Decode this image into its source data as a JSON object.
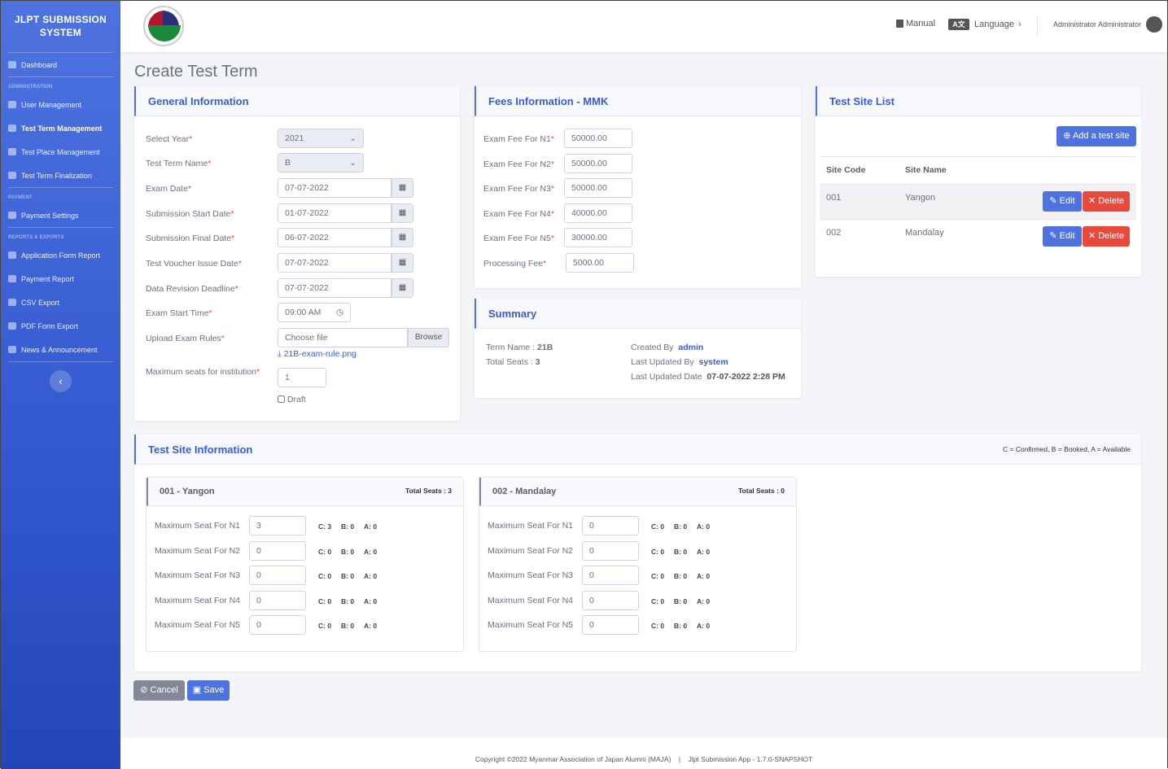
{
  "app": {
    "brand": "JLPT SUBMISSION SYSTEM",
    "logo_text": "Myanmar Association of Japan Alumni"
  },
  "sidebar": {
    "items": [
      {
        "type": "item",
        "label": "Dashboard",
        "icon": "tachometer-icon"
      },
      {
        "type": "head",
        "label": "ADMINISTRATION"
      },
      {
        "type": "item",
        "label": "User Management",
        "icon": "user-cog-icon"
      },
      {
        "type": "item",
        "label": "Test Term Management",
        "icon": "paper-plane-icon",
        "active": true
      },
      {
        "type": "item",
        "label": "Test Place Management",
        "icon": "building-icon"
      },
      {
        "type": "item",
        "label": "Test Term Finalization",
        "icon": "id-card-icon"
      },
      {
        "type": "head",
        "label": "PAYMENT"
      },
      {
        "type": "item",
        "label": "Payment Settings",
        "icon": "credit-card-icon"
      },
      {
        "type": "head",
        "label": "REPORTS & EXPORTS"
      },
      {
        "type": "item",
        "label": "Application Form Report",
        "icon": "file-icon"
      },
      {
        "type": "item",
        "label": "Payment Report",
        "icon": "file-invoice-icon"
      },
      {
        "type": "item",
        "label": "CSV Export",
        "icon": "file-csv-icon"
      },
      {
        "type": "item",
        "label": "PDF Form Export",
        "icon": "file-pdf-icon"
      },
      {
        "type": "item",
        "label": "News & Announcement",
        "icon": "newspaper-icon"
      }
    ],
    "toggle": "‹"
  },
  "topbar": {
    "manual": "Manual",
    "language": "Language",
    "user": "Administrator Administrator"
  },
  "page_title": "Create Test Term",
  "general": {
    "title": "General Information",
    "fields": [
      {
        "label": "Select Year",
        "value": "2021",
        "kind": "select"
      },
      {
        "label": "Test Term Name",
        "value": "B",
        "kind": "select"
      },
      {
        "label": "Exam Date",
        "value": "07-07-2022",
        "kind": "date"
      },
      {
        "label": "Submission Start Date",
        "value": "01-07-2022",
        "kind": "date"
      },
      {
        "label": "Submission Final Date",
        "value": "06-07-2022",
        "kind": "date"
      },
      {
        "label": "Test Voucher Issue Date",
        "value": "07-07-2022",
        "kind": "date"
      },
      {
        "label": "Data Revision Deadline",
        "value": "07-07-2022",
        "kind": "date"
      },
      {
        "label": "Exam Start Time",
        "value": "09:00 AM",
        "kind": "time"
      },
      {
        "label": "Upload Exam Rules",
        "value": "Choose file",
        "kind": "file"
      }
    ],
    "browse": "Browse",
    "file_link": "21B-exam-rule.png",
    "max_seats_label": "Maximum seats for institution",
    "max_seats": "1",
    "draft": "Draft",
    "draft_checked": false
  },
  "fees": {
    "title": "Fees Information - MMK",
    "rows": [
      {
        "label": "Exam Fee For N1",
        "value": "50000.00"
      },
      {
        "label": "Exam Fee For N2",
        "value": "50000.00"
      },
      {
        "label": "Exam Fee For N3",
        "value": "50000.00"
      },
      {
        "label": "Exam Fee For N4",
        "value": "40000.00"
      },
      {
        "label": "Exam Fee For N5",
        "value": "30000.00"
      },
      {
        "label": "Processing Fee",
        "value": "5000.00"
      }
    ]
  },
  "summary": {
    "title": "Summary",
    "term_name_label": "Term Name :",
    "term_name": "21B",
    "total_seats_label": "Total Seats :",
    "total_seats": "3",
    "created_by_label": "Created By",
    "created_by": "admin",
    "updated_by_label": "Last Updated By",
    "updated_by": "system",
    "updated_date_label": "Last Updated Date",
    "updated_date": "07-07-2022 2:28 PM"
  },
  "site_list": {
    "title": "Test Site List",
    "add_button": "Add a test site",
    "headers": [
      "Site Code",
      "Site Name"
    ],
    "rows": [
      {
        "code": "001",
        "name": "Yangon"
      },
      {
        "code": "002",
        "name": "Mandalay"
      }
    ],
    "edit": "Edit",
    "delete": "Delete"
  },
  "site_info": {
    "title": "Test Site Information",
    "legend": "C = Confirmed, B = Booked, A = Available",
    "sites": [
      {
        "title": "001 - Yangon",
        "total": "Total Seats : 3",
        "rows": [
          {
            "label": "Maximum Seat For N1",
            "value": "3",
            "c": "C: 3",
            "b": "B: 0",
            "a": "A: 0"
          },
          {
            "label": "Maximum Seat For N2",
            "value": "0",
            "c": "C: 0",
            "b": "B: 0",
            "a": "A: 0"
          },
          {
            "label": "Maximum Seat For N3",
            "value": "0",
            "c": "C: 0",
            "b": "B: 0",
            "a": "A: 0"
          },
          {
            "label": "Maximum Seat For N4",
            "value": "0",
            "c": "C: 0",
            "b": "B: 0",
            "a": "A: 0"
          },
          {
            "label": "Maximum Seat For N5",
            "value": "0",
            "c": "C: 0",
            "b": "B: 0",
            "a": "A: 0"
          }
        ]
      },
      {
        "title": "002 - Mandalay",
        "total": "Total Seats : 0",
        "rows": [
          {
            "label": "Maximum Seat For N1",
            "value": "0",
            "c": "C: 0",
            "b": "B: 0",
            "a": "A: 0"
          },
          {
            "label": "Maximum Seat For N2",
            "value": "0",
            "c": "C: 0",
            "b": "B: 0",
            "a": "A: 0"
          },
          {
            "label": "Maximum Seat For N3",
            "value": "0",
            "c": "C: 0",
            "b": "B: 0",
            "a": "A: 0"
          },
          {
            "label": "Maximum Seat For N4",
            "value": "0",
            "c": "C: 0",
            "b": "B: 0",
            "a": "A: 0"
          },
          {
            "label": "Maximum Seat For N5",
            "value": "0",
            "c": "C: 0",
            "b": "B: 0",
            "a": "A: 0"
          }
        ]
      }
    ]
  },
  "actions": {
    "cancel": "Cancel",
    "save": "Save"
  },
  "footer": {
    "copyright": "Copyright ©2022 Myanmar Association of Japan Alumni (MAJA)",
    "separator": "|",
    "version": "Jlpt Submission App - 1.7.0-SNAPSHOT"
  },
  "colors": {
    "primary": "#4e73df",
    "danger": "#e74a3b",
    "secondary": "#858796"
  }
}
